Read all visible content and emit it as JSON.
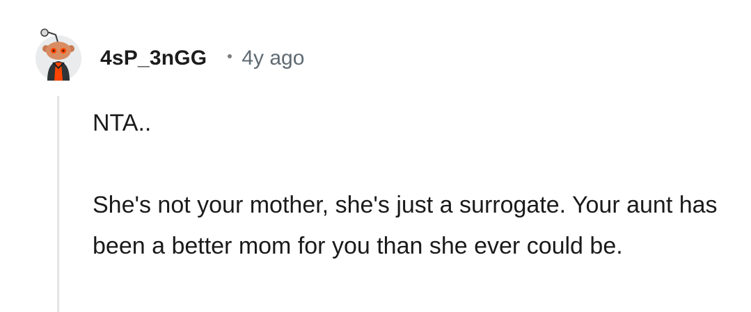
{
  "comment": {
    "author": "4sP_3nGG",
    "timestamp": "4y ago",
    "paragraphs": [
      "NTA..",
      "She's not your mother, she's just a surrogate. Your aunt has been a better mom for you than she ever could be."
    ]
  },
  "icons": {
    "avatar": "reddit-snoo-avatar-icon",
    "separator": "dot-separator-icon"
  },
  "colors": {
    "username": "#1c1c1c",
    "timestamp": "#5f6a72",
    "thread_line": "#e3e3e3",
    "avatar_accent": "#ff4500"
  }
}
